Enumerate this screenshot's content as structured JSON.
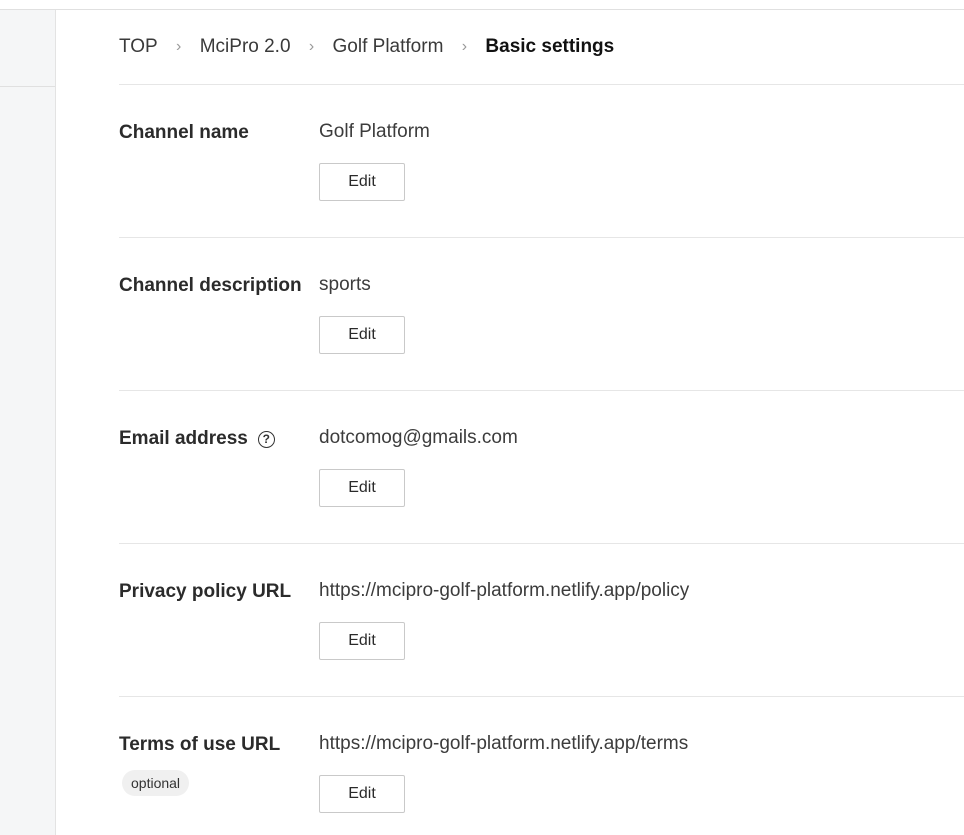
{
  "breadcrumb": {
    "items": [
      "TOP",
      "MciPro 2.0",
      "Golf Platform"
    ],
    "current": "Basic settings",
    "separator": "›"
  },
  "settings": [
    {
      "label": "Channel name",
      "value": "Golf Platform",
      "edit_label": "Edit"
    },
    {
      "label": "Channel description",
      "value": "sports",
      "edit_label": "Edit"
    },
    {
      "label": "Email address",
      "help_icon": "?",
      "value": "dotcomog@gmails.com",
      "edit_label": "Edit"
    },
    {
      "label": "Privacy policy URL",
      "value": "https://mcipro-golf-platform.netlify.app/policy",
      "edit_label": "Edit"
    },
    {
      "label": "Terms of use URL",
      "badge": "optional",
      "value": "https://mcipro-golf-platform.netlify.app/terms",
      "edit_label": "Edit"
    }
  ]
}
